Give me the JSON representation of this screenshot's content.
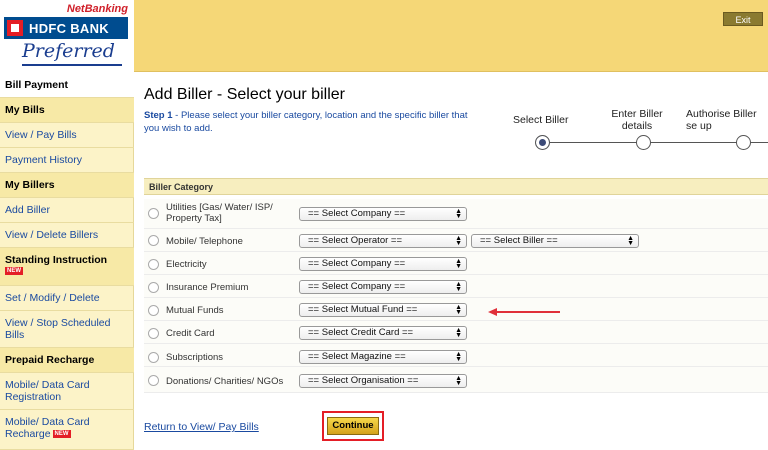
{
  "header": {
    "netbanking": "NetBanking",
    "bank_name": "HDFC BANK",
    "preferred": "Preferred",
    "exit_label": "Exit",
    "header_color": "#f5d777"
  },
  "sidebar": {
    "items": [
      {
        "label": "Bill Payment",
        "type": "active"
      },
      {
        "label": "My Bills",
        "type": "head"
      },
      {
        "label": "View / Pay Bills",
        "type": "link"
      },
      {
        "label": "Payment History",
        "type": "link"
      },
      {
        "label": "My Billers",
        "type": "head"
      },
      {
        "label": "Add Biller",
        "type": "link"
      },
      {
        "label": "View / Delete Billers",
        "type": "link"
      },
      {
        "label": "Standing Instruction",
        "type": "head",
        "badge": "NEW"
      },
      {
        "label": "Set / Modify / Delete",
        "type": "link"
      },
      {
        "label": "View / Stop Scheduled Bills",
        "type": "link"
      },
      {
        "label": "Prepaid Recharge",
        "type": "head"
      },
      {
        "label": "Mobile/ Data Card Registration",
        "type": "link"
      },
      {
        "label": "Mobile/ Data Card Recharge",
        "type": "link",
        "badge": "NEW"
      }
    ]
  },
  "main": {
    "title": "Add Biller - Select your biller",
    "step_prefix": "Step 1",
    "step_text": " - Please select your biller category, location and the specific biller that you wish to add.",
    "steps": [
      {
        "label": "Select Biller",
        "active": true
      },
      {
        "label": "Enter Biller details",
        "active": false
      },
      {
        "label": "Authorise Biller se up",
        "active": false
      }
    ],
    "category_header": "Biller Category",
    "categories": [
      {
        "label": "Utilities [Gas/ Water/ ISP/ Property Tax]",
        "select": "== Select Company =="
      },
      {
        "label": "Mobile/ Telephone",
        "select": "== Select Operator ==",
        "select2": "== Select Biller =="
      },
      {
        "label": "Electricity",
        "select": "== Select Company =="
      },
      {
        "label": "Insurance Premium",
        "select": "== Select Company =="
      },
      {
        "label": "Mutual Funds",
        "select": "== Select Mutual Fund =="
      },
      {
        "label": "Credit Card",
        "select": "== Select Credit Card =="
      },
      {
        "label": "Subscriptions",
        "select": "== Select Magazine =="
      },
      {
        "label": "Donations/ Charities/ NGOs",
        "select": "== Select Organisation =="
      }
    ],
    "return_link": "Return to View/ Pay Bills",
    "continue_label": "Continue",
    "highlight_color": "#e41e26"
  }
}
